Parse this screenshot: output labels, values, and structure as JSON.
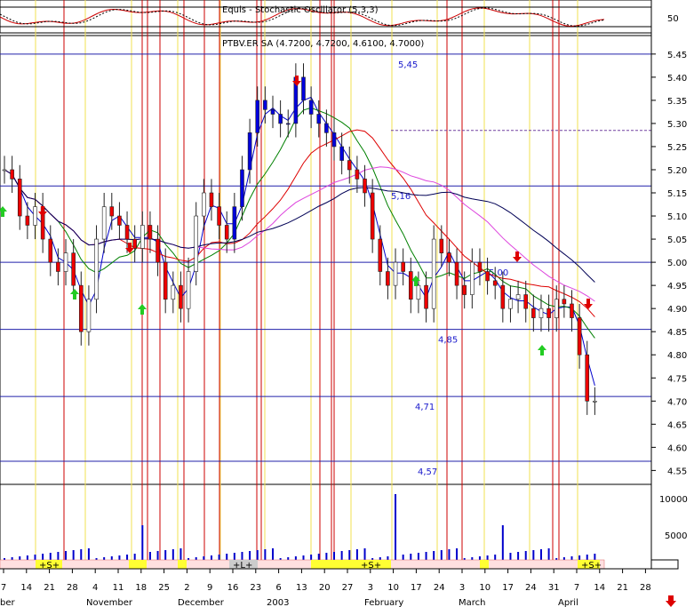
{
  "chart_data": {
    "type": "candlestick",
    "titles": {
      "oscillator": "Equis - Stochastic Oscillator (5,3,3)",
      "price": "PTBV.ER SA (4.7200, 4.7200, 4.6100, 4.7000)"
    },
    "oscillator_axis": {
      "ticks": [
        50
      ]
    },
    "price_axis": {
      "ylim": [
        4.52,
        5.49
      ],
      "ticks": [
        "5.45",
        "5.40",
        "5.35",
        "5.30",
        "5.25",
        "5.20",
        "5.15",
        "5.10",
        "5.05",
        "5.00",
        "4.95",
        "4.90",
        "4.85",
        "4.80",
        "4.75",
        "4.70",
        "4.65",
        "4.60",
        "4.55"
      ]
    },
    "volume_axis": {
      "ticks": [
        "10000",
        "5000"
      ]
    },
    "horizontal_levels": [
      {
        "label": "5,45",
        "value": 5.45
      },
      {
        "label": "5,16",
        "value": 5.165
      },
      {
        "label": "5,00",
        "value": 5.0
      },
      {
        "label": "4,85",
        "value": 4.855
      },
      {
        "label": "4,71",
        "value": 4.71
      },
      {
        "label": "4,57",
        "value": 4.57
      }
    ],
    "dashed_level": 5.285,
    "x_day_ticks": [
      "7",
      "14",
      "21",
      "28",
      "4",
      "11",
      "18",
      "25",
      "2",
      "9",
      "16",
      "23",
      "6",
      "13",
      "20",
      "27",
      "3",
      "10",
      "17",
      "24",
      "3",
      "10",
      "17",
      "24",
      "31",
      "7",
      "14",
      "21",
      "28"
    ],
    "x_month_labels": [
      "ber",
      "November",
      "December",
      "2003",
      "February",
      "March",
      "April"
    ],
    "band_labels": [
      "+S+",
      "+L+",
      "+S+",
      "+S+"
    ],
    "closes": [
      5.2,
      5.18,
      5.1,
      5.08,
      5.12,
      5.05,
      5.0,
      4.98,
      5.02,
      4.95,
      4.85,
      4.92,
      5.05,
      5.12,
      5.1,
      5.08,
      5.05,
      5.03,
      5.08,
      5.05,
      5.0,
      4.92,
      4.95,
      4.9,
      4.98,
      5.1,
      5.15,
      5.12,
      5.08,
      5.05,
      5.12,
      5.2,
      5.28,
      5.35,
      5.33,
      5.32,
      5.3,
      5.3,
      5.4,
      5.35,
      5.32,
      5.3,
      5.28,
      5.25,
      5.22,
      5.2,
      5.18,
      5.15,
      5.05,
      4.98,
      4.95,
      5.0,
      4.98,
      4.92,
      4.95,
      4.9,
      5.05,
      5.02,
      5.0,
      4.95,
      4.93,
      5.0,
      4.98,
      4.96,
      4.95,
      4.9,
      4.92,
      4.93,
      4.9,
      4.88,
      4.9,
      4.88,
      4.92,
      4.91,
      4.88,
      4.8,
      4.7,
      4.7
    ],
    "volume_spikes": [
      {
        "label": "December",
        "value": 10500
      },
      {
        "label": "March",
        "value": 5500
      }
    ]
  }
}
